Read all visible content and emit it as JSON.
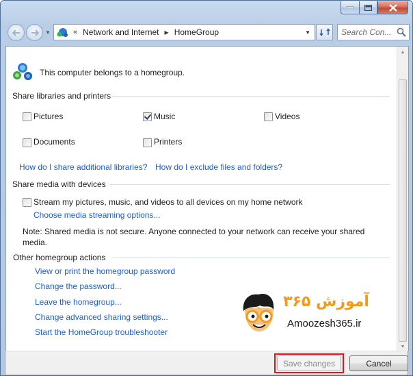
{
  "nav": {
    "breadcrumb_chevrons": "«",
    "crumbs": [
      "Network and Internet",
      "HomeGroup"
    ],
    "search_placeholder": "Search Con..."
  },
  "main": {
    "status_text": "This computer belongs to a homegroup.",
    "share_libraries": {
      "title": "Share libraries and printers",
      "items": [
        {
          "label": "Pictures",
          "checked": false
        },
        {
          "label": "Music",
          "checked": true
        },
        {
          "label": "Videos",
          "checked": false
        },
        {
          "label": "Documents",
          "checked": false
        },
        {
          "label": "Printers",
          "checked": false
        }
      ],
      "links": [
        "How do I share additional libraries?",
        "How do I exclude files and folders?"
      ]
    },
    "share_media": {
      "title": "Share media with devices",
      "stream_label": "Stream my pictures, music, and videos to all devices on my home network",
      "stream_checked": false,
      "options_link": "Choose media streaming options...",
      "note": "Note: Shared media is not secure. Anyone connected to your network can receive your shared media."
    },
    "other_actions": {
      "title": "Other homegroup actions",
      "links": [
        "View or print the homegroup password",
        "Change the password...",
        "Leave the homegroup...",
        "Change advanced sharing settings...",
        "Start the HomeGroup troubleshooter"
      ]
    }
  },
  "watermark": {
    "persian_text": "آموزش ۳۶۵",
    "site": "Amoozesh365.ir"
  },
  "buttons": {
    "save": "Save changes",
    "cancel": "Cancel"
  },
  "colors": {
    "link": "#1c61c3",
    "highlight_box": "#e3141c",
    "logo_orange": "#f29a1d"
  }
}
